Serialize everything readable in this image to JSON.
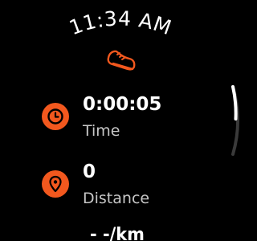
{
  "status": {
    "time": "11:34 AM"
  },
  "activity": {
    "icon": "running-shoe-icon"
  },
  "metrics": [
    {
      "value": "0:00:05",
      "label": "Time",
      "icon": "clock-icon"
    },
    {
      "value": "0",
      "label": "Distance",
      "icon": "location-pin-icon"
    }
  ],
  "next_metric": {
    "partial_text": "- -/km"
  },
  "colors": {
    "accent": "#f2581e",
    "background": "#000000",
    "primary_text": "#ffffff",
    "secondary_text": "#c7c7c7"
  }
}
